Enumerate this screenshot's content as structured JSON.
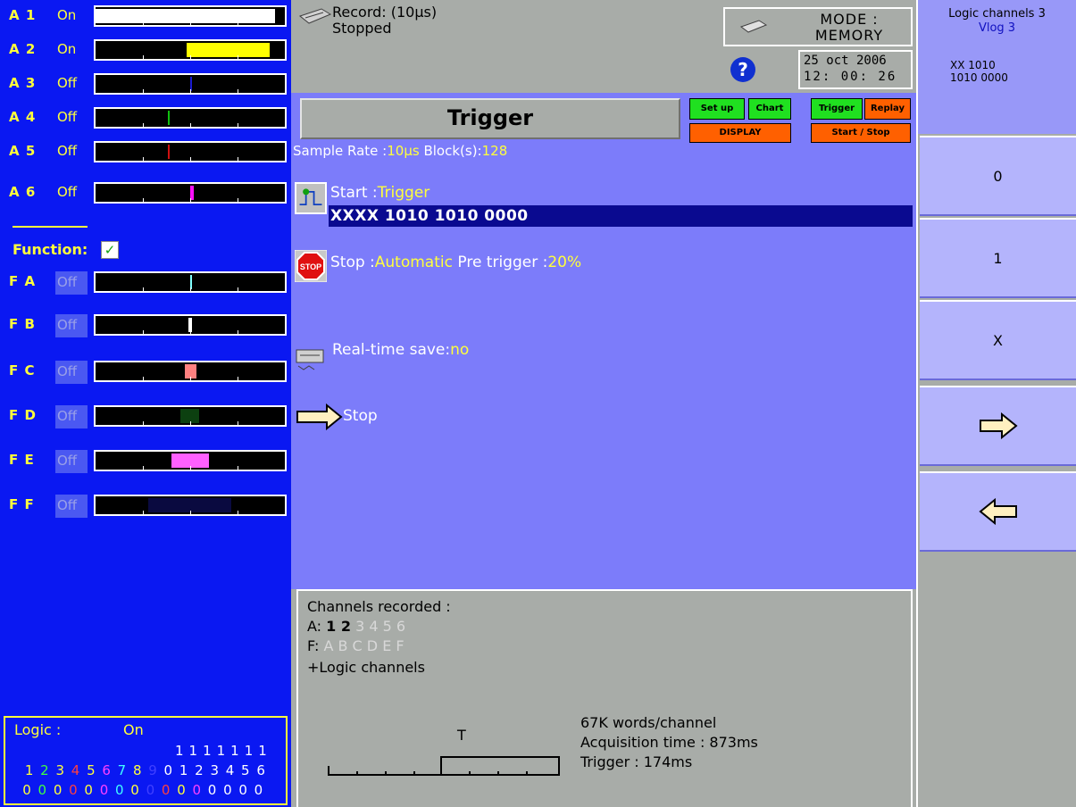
{
  "analog_channels": [
    {
      "label": "A 1",
      "state": "On",
      "fill_color": "#ffffff",
      "fill_start": 0.0,
      "fill_end": 0.95
    },
    {
      "label": "A 2",
      "state": "On",
      "fill_color": "#ffff00",
      "fill_start": 0.48,
      "fill_end": 0.92
    },
    {
      "label": "A 3",
      "state": "Off",
      "fill_color": "#1a1ad0",
      "fill_start": 0.5,
      "fill_end": 0.51
    },
    {
      "label": "A 4",
      "state": "Off",
      "fill_color": "#10c010",
      "fill_start": 0.38,
      "fill_end": 0.39
    },
    {
      "label": "A 5",
      "state": "Off",
      "fill_color": "#d01010",
      "fill_start": 0.38,
      "fill_end": 0.39
    },
    {
      "label": "A 6",
      "state": "Off",
      "fill_color": "#ff10ff",
      "fill_start": 0.5,
      "fill_end": 0.52
    }
  ],
  "function": {
    "title": "Function:",
    "checked": true
  },
  "function_channels": [
    {
      "label": "F A",
      "state": "Off",
      "fill_color": "#80ffff",
      "fill_start": 0.5,
      "fill_end": 0.51
    },
    {
      "label": "F B",
      "state": "Off",
      "fill_color": "#ffffff",
      "fill_start": 0.49,
      "fill_end": 0.51
    },
    {
      "label": "F C",
      "state": "Off",
      "fill_color": "#ff8080",
      "fill_start": 0.47,
      "fill_end": 0.53
    },
    {
      "label": "F D",
      "state": "Off",
      "fill_color": "#0c4010",
      "fill_start": 0.45,
      "fill_end": 0.55
    },
    {
      "label": "F E",
      "state": "Off",
      "fill_color": "#ff60ff",
      "fill_start": 0.4,
      "fill_end": 0.6
    },
    {
      "label": "F F",
      "state": "Off",
      "fill_color": "#0a0a40",
      "fill_start": 0.28,
      "fill_end": 0.72
    }
  ],
  "logic": {
    "title": "Logic :",
    "state": "On",
    "tens": "1111111",
    "numbers": [
      "1",
      "2",
      "3",
      "4",
      "5",
      "6",
      "7",
      "8",
      "9",
      "0",
      "1",
      "2",
      "3",
      "4",
      "5",
      "6"
    ],
    "number_colors": [
      "#ffff3c",
      "#40ff40",
      "#ffff3c",
      "#ff4040",
      "#ffff3c",
      "#ff40ff",
      "#40ffff",
      "#ffff3c",
      "#4040ff",
      "#ffffff",
      "#ffffff",
      "#ffffff",
      "#ffffff",
      "#ffffff",
      "#ffffff",
      "#ffffff"
    ],
    "values": [
      "0",
      "0",
      "0",
      "0",
      "0",
      "0",
      "0",
      "0",
      "0",
      "0",
      "0",
      "0",
      "0",
      "0",
      "0",
      "0"
    ],
    "value_colors": [
      "#ffff3c",
      "#40ff40",
      "#ffff3c",
      "#ff4040",
      "#ffff3c",
      "#ff40ff",
      "#40ffff",
      "#ffff3c",
      "#4040ff",
      "#ff4040",
      "#ffff3c",
      "#ff40ff",
      "#ffffff",
      "#ffffff",
      "#ffffff",
      "#ffffff"
    ]
  },
  "record": {
    "line1": "Record: (10µs)",
    "line2": "Stopped"
  },
  "mode": {
    "line1": "MODE :",
    "line2": "MEMORY"
  },
  "datetime": {
    "date": "25 oct 2006",
    "time": "12: 00: 26"
  },
  "help_glyph": "?",
  "title": "Trigger",
  "tabs": {
    "setup": "Set up",
    "chart": "Chart",
    "trigger": "Trigger",
    "replay": "Replay",
    "display": "DISPLAY",
    "start_stop": "Start / Stop"
  },
  "sample": {
    "label_rate": "Sample Rate :",
    "rate": "10µs",
    "label_blocks": " Block(s):",
    "blocks": "128"
  },
  "start": {
    "label": "Start :",
    "value": "Trigger",
    "pattern": "XXXX 1010 1010 0000"
  },
  "stop": {
    "label": "Stop  :",
    "value": "Automatic",
    "pre_label": "  Pre trigger :",
    "pre_value": "20%",
    "icon_text": "STOP"
  },
  "save": {
    "label": "Real-time save:",
    "value": "no"
  },
  "next": {
    "label": "Stop"
  },
  "info": {
    "title": "Channels recorded :",
    "a_prefix": "A: ",
    "a_active": "1 2",
    "a_inactive": " 3 4 5 6",
    "f_prefix": "F: ",
    "f_inactive": "A B C D E F",
    "logic_line": "+Logic channels",
    "t_marker": "T",
    "words": "67K words/channel",
    "acquisition": "Acquisition time : 873ms",
    "trigger": "Trigger : 174ms",
    "pre_trigger_fraction": 0.2
  },
  "right_panel": {
    "line1": "Logic channels 3",
    "line2": "Vlog 3",
    "line3": "XX  1010",
    "line4": "1010 0000",
    "buttons": [
      "0",
      "1",
      "X"
    ]
  },
  "colors": {
    "panel_blue": "#0a18f2",
    "main_purple": "#7c7cfa",
    "accent_yellow": "#ffff3c",
    "gray": "#a8aca8"
  }
}
